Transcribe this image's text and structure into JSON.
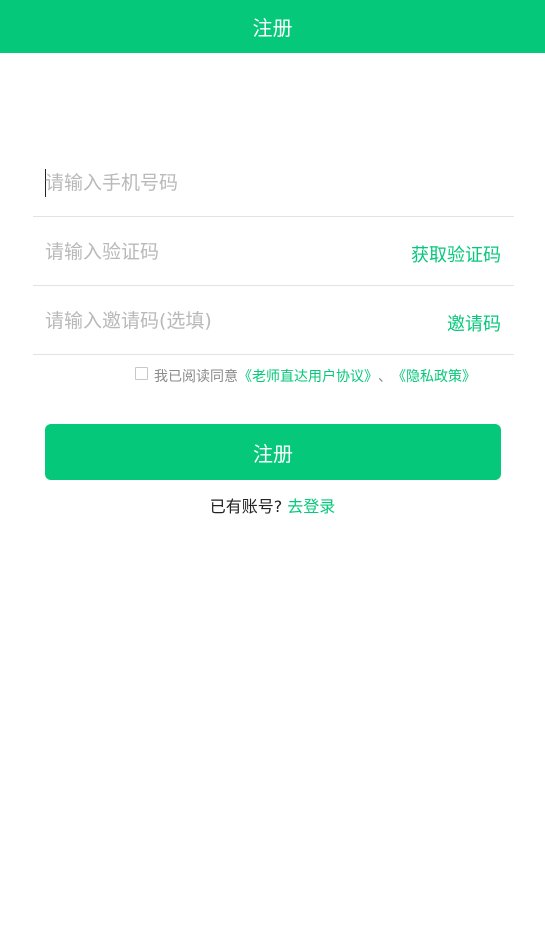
{
  "header": {
    "title": "注册"
  },
  "form": {
    "phone_placeholder": "请输入手机号码",
    "code_placeholder": "请输入验证码",
    "get_code_label": "获取验证码",
    "invite_placeholder": "请输入邀请码(选填)",
    "invite_label": "邀请码"
  },
  "agreement": {
    "prefix": "我已阅读同意",
    "user_agreement": "《老师直达用户协议》",
    "separator": "、",
    "privacy_policy": "《隐私政策》",
    "checked": false
  },
  "submit_label": "注册",
  "login": {
    "prompt": "已有账号?",
    "link": "去登录"
  },
  "colors": {
    "accent": "#06c87a",
    "placeholder": "#b9b9b9",
    "divider": "#e3e3e3"
  }
}
